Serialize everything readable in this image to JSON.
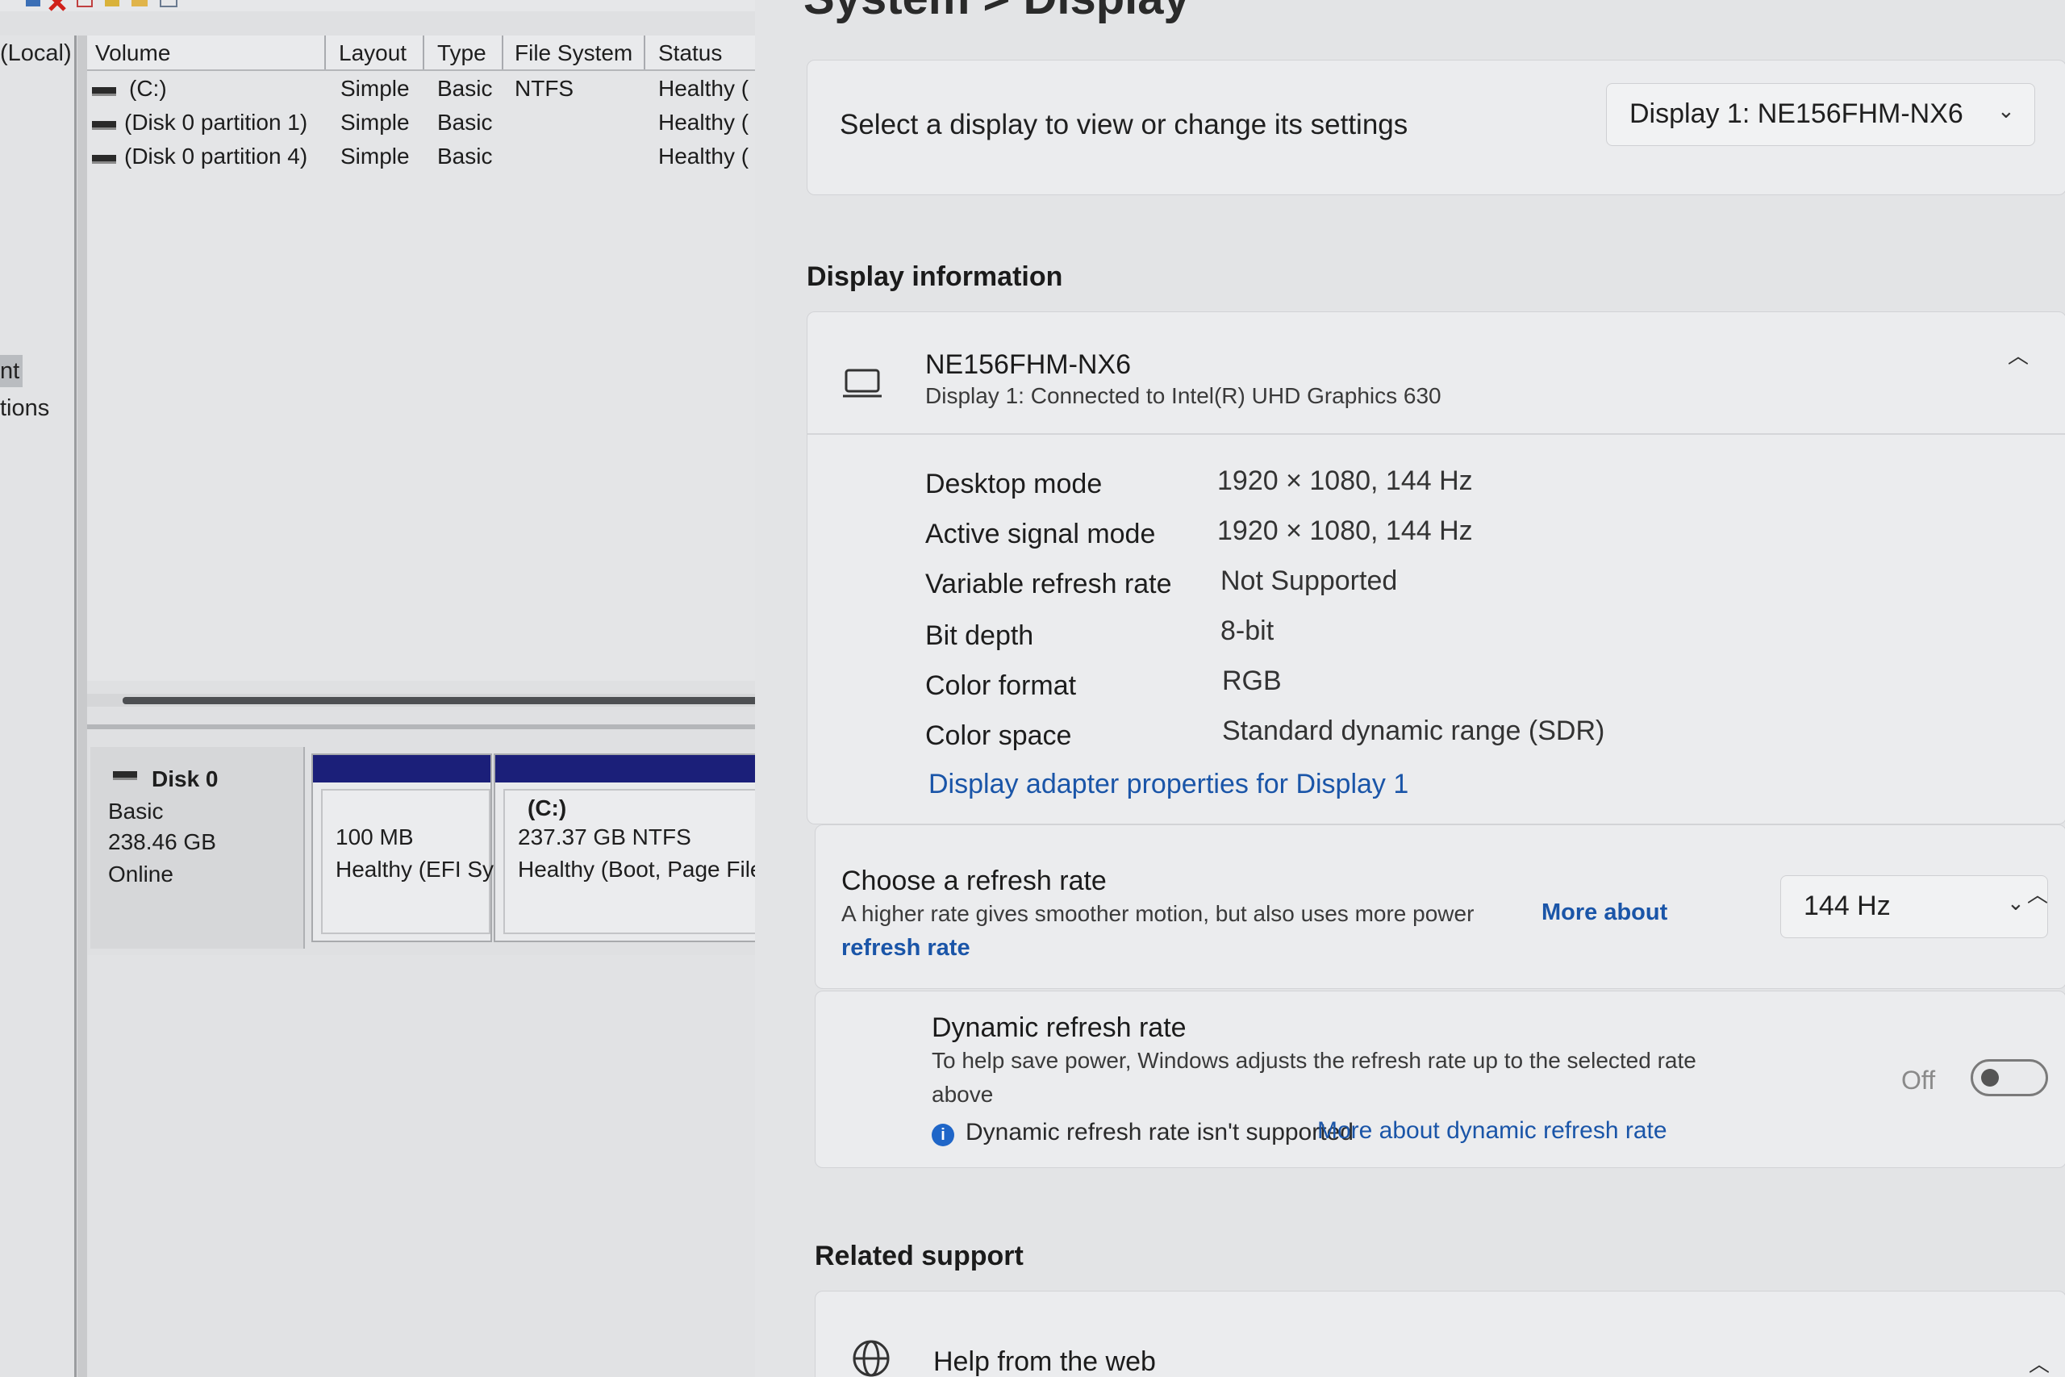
{
  "disk_management": {
    "tree": {
      "local_label": "(Local)",
      "item_partial_1": "nt",
      "item_partial_2": "tions"
    },
    "columns": [
      "Volume",
      "Layout",
      "Type",
      "File System",
      "Status"
    ],
    "volumes": [
      {
        "volume": "(C:)",
        "layout": "Simple",
        "type": "Basic",
        "fs": "NTFS",
        "status": "Healthy ("
      },
      {
        "volume": "(Disk 0 partition 1)",
        "layout": "Simple",
        "type": "Basic",
        "fs": "",
        "status": "Healthy ("
      },
      {
        "volume": "(Disk 0 partition 4)",
        "layout": "Simple",
        "type": "Basic",
        "fs": "",
        "status": "Healthy ("
      }
    ],
    "disk": {
      "name": "Disk 0",
      "type": "Basic",
      "size": "238.46 GB",
      "state": "Online"
    },
    "partitions": [
      {
        "label": "",
        "size": "100 MB",
        "status": "Healthy (EFI Sy"
      },
      {
        "label": "(C:)",
        "size": "237.37 GB NTFS",
        "status": "Healthy (Boot, Page File"
      }
    ]
  },
  "settings": {
    "breadcrumb": "System  >  Display",
    "select_display_label": "Select a display to view or change its settings",
    "selected_display": "Display 1: NE156FHM-NX6",
    "display_info_heading": "Display information",
    "monitor": {
      "name": "NE156FHM-NX6",
      "subtitle": "Display 1: Connected to Intel(R) UHD Graphics 630"
    },
    "specs": [
      {
        "label": "Desktop mode",
        "value": "1920 × 1080, 144 Hz"
      },
      {
        "label": "Active signal mode",
        "value": "1920 × 1080, 144 Hz"
      },
      {
        "label": "Variable refresh rate",
        "value": "Not Supported"
      },
      {
        "label": "Bit depth",
        "value": "8-bit"
      },
      {
        "label": "Color format",
        "value": "RGB"
      },
      {
        "label": "Color space",
        "value": "Standard dynamic range (SDR)"
      }
    ],
    "adapter_link": "Display adapter properties for Display 1",
    "refresh": {
      "title": "Choose a refresh rate",
      "description": "A higher rate gives smoother motion, but also uses more power",
      "more_link_1": "More about",
      "more_link_2": "refresh rate",
      "value": "144 Hz"
    },
    "dynamic_refresh": {
      "title": "Dynamic refresh rate",
      "description_1": "To help save power, Windows adjusts the refresh rate up to the selected rate",
      "description_2": "above",
      "warning": "Dynamic refresh rate isn't supported",
      "link": "More about dynamic refresh rate",
      "toggle_label": "Off",
      "toggle_on": false
    },
    "related_support_heading": "Related support",
    "help_from_web": "Help from the web"
  }
}
